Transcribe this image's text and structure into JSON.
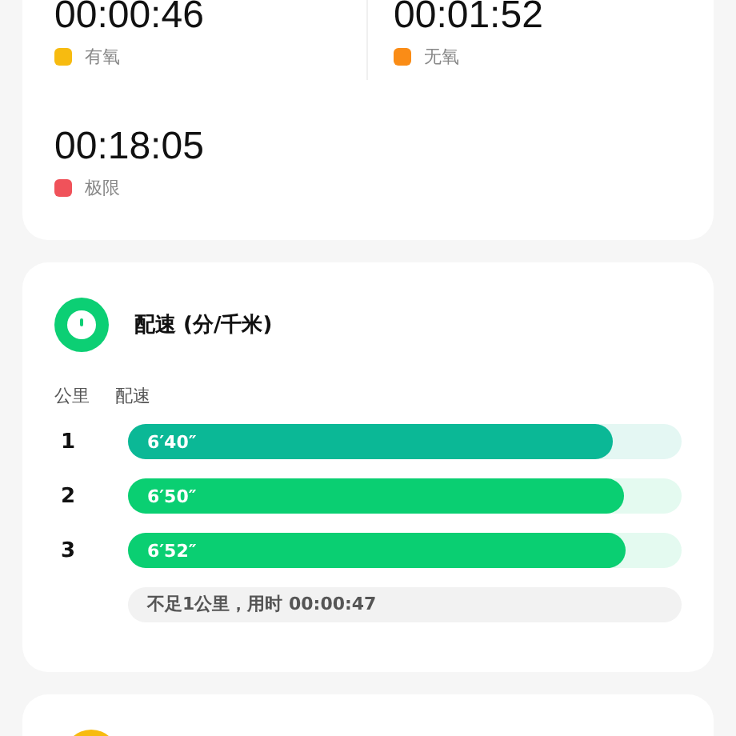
{
  "zones": [
    {
      "time": "00:00:46",
      "label": "有氧",
      "color": "#f7bb10"
    },
    {
      "time": "00:01:52",
      "label": "无氧",
      "color": "#fa8c16"
    },
    {
      "time": "00:18:05",
      "label": "极限",
      "color": "#f0525a"
    }
  ],
  "pace": {
    "title": "配速 (分/千米)",
    "col_km": "公里",
    "col_pace": "配速",
    "rows": [
      {
        "km": "1",
        "pace": "6′40″",
        "level": 0.876,
        "color": "#0bb896"
      },
      {
        "km": "2",
        "pace": "6′50″",
        "level": 0.896,
        "color": "#0acf72"
      },
      {
        "km": "3",
        "pace": "6′52″",
        "level": 0.9,
        "color": "#0acf72"
      }
    ],
    "note": "不足1公里，用时 00:00:47"
  }
}
